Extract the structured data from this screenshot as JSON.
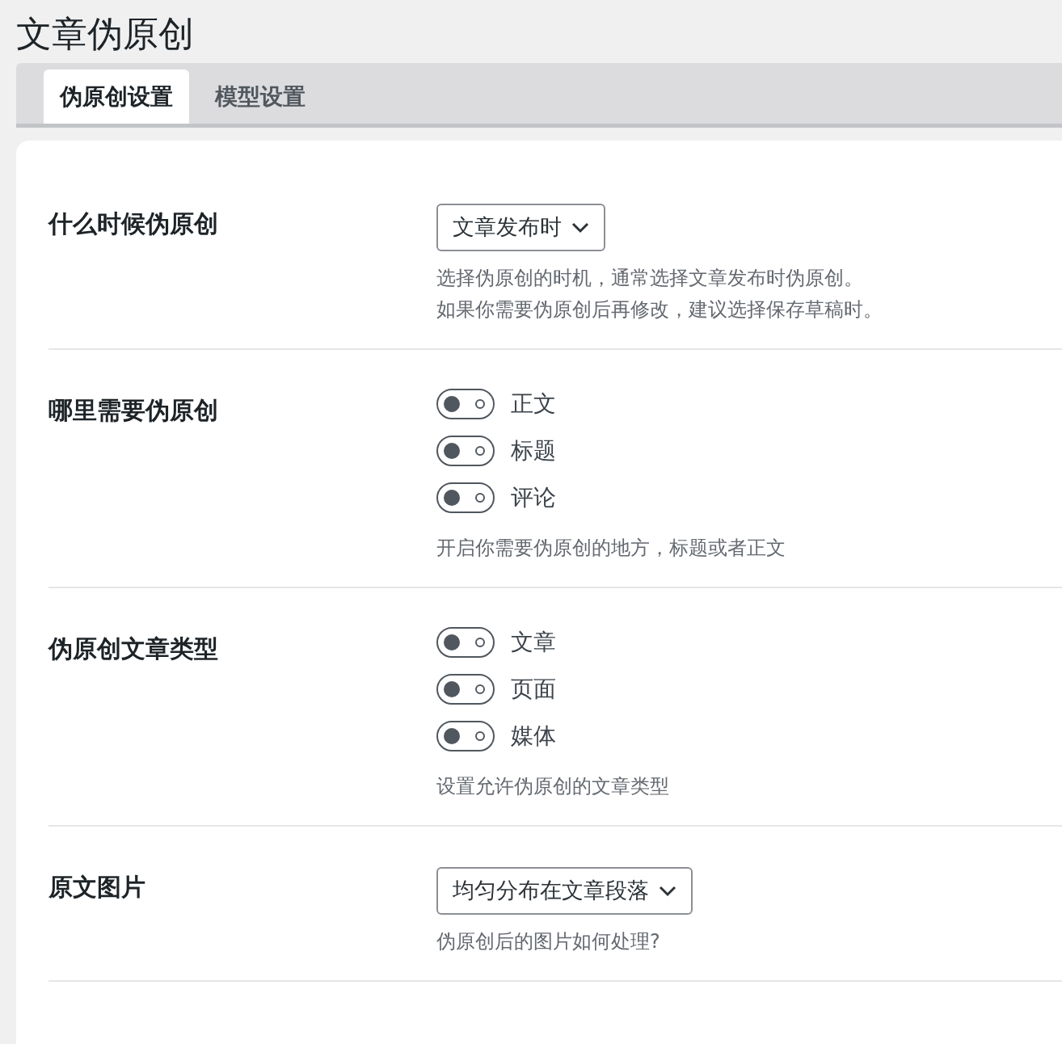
{
  "title": "文章伪原创",
  "tabs": [
    {
      "label": "伪原创设置",
      "selected": true
    },
    {
      "label": "模型设置",
      "selected": false
    }
  ],
  "sections": [
    {
      "kind": "select",
      "label": "什么时候伪原创",
      "value": "文章发布时",
      "description": [
        "选择伪原创的时机，通常选择文章发布时伪原创。",
        "如果你需要伪原创后再修改，建议选择保存草稿时。"
      ]
    },
    {
      "kind": "toggles",
      "label": "哪里需要伪原创",
      "toggles": [
        {
          "label": "正文",
          "on": false
        },
        {
          "label": "标题",
          "on": false
        },
        {
          "label": "评论",
          "on": false
        }
      ],
      "description": [
        "开启你需要伪原创的地方，标题或者正文"
      ]
    },
    {
      "kind": "toggles",
      "label": "伪原创文章类型",
      "toggles": [
        {
          "label": "文章",
          "on": false
        },
        {
          "label": "页面",
          "on": false
        },
        {
          "label": "媒体",
          "on": false
        }
      ],
      "description": [
        "设置允许伪原创的文章类型"
      ]
    },
    {
      "kind": "select",
      "label": "原文图片",
      "value": "均匀分布在文章段落",
      "description": [
        "伪原创后的图片如何处理?"
      ]
    }
  ]
}
